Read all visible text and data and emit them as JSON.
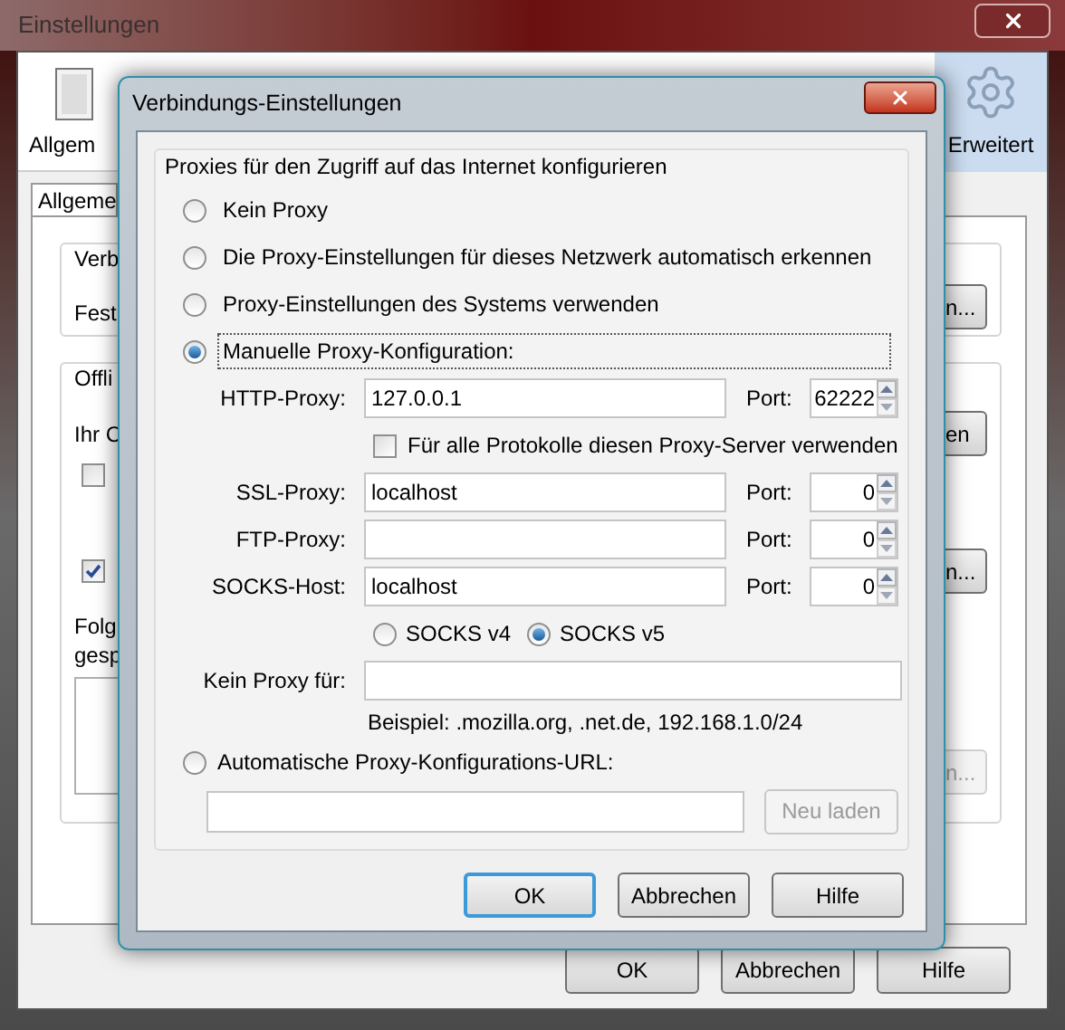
{
  "window": {
    "title": "Einstellungen"
  },
  "toolbar": [
    {
      "label": "Allgem",
      "selected": false
    },
    {
      "label": "Erweitert",
      "selected": true
    }
  ],
  "tab": {
    "label": "Allgeme",
    "selected": true
  },
  "background": {
    "group_1": [
      "Verb",
      "Fest"
    ],
    "group_2": [
      "Offli",
      "Ihr C",
      "Folg",
      "gesp"
    ],
    "checkboxes": [
      {
        "checked": false
      },
      {
        "checked": true
      }
    ],
    "side_buttons": [
      {
        "label": "n...",
        "disabled": false
      },
      {
        "label": "en",
        "disabled": false
      },
      {
        "label": "n...",
        "disabled": false
      },
      {
        "label": "n...",
        "disabled": true
      }
    ],
    "buttons": [
      "OK",
      "Abbrechen",
      "Hilfe"
    ]
  },
  "dialog": {
    "title": "Verbindungs-Einstellungen",
    "group_label": "Proxies für den Zugriff auf das Internet konfigurieren",
    "modes": [
      {
        "label": "Kein Proxy",
        "selected": false
      },
      {
        "label": "Die Proxy-Einstellungen für dieses Netzwerk automatisch erkennen",
        "selected": false
      },
      {
        "label": "Proxy-Einstellungen des Systems verwenden",
        "selected": false
      },
      {
        "label": "Manuelle Proxy-Konfiguration:",
        "selected": true
      }
    ],
    "proxies": [
      {
        "label": "HTTP-Proxy:",
        "value": "127.0.0.1",
        "port_label": "Port:",
        "port": "62222"
      },
      {
        "label": "SSL-Proxy:",
        "value": "localhost",
        "port_label": "Port:",
        "port": "0"
      },
      {
        "label": "FTP-Proxy:",
        "port_label": "Port:",
        "port": "0"
      },
      {
        "label": "SOCKS-Host:",
        "value": "localhost",
        "port_label": "Port:",
        "port": "0"
      }
    ],
    "share_all": {
      "label": "Für alle Protokolle diesen Proxy-Server verwenden",
      "checked": false
    },
    "socks_versions": [
      {
        "label": "SOCKS v4",
        "selected": false
      },
      {
        "label": "SOCKS v5",
        "selected": true
      }
    ],
    "no_proxy": {
      "label": "Kein Proxy für:"
    },
    "example": "Beispiel: .mozilla.org, .net.de, 192.168.1.0/24",
    "auto_url": {
      "label": "Automatische Proxy-Konfigurations-URL:",
      "selected": false,
      "reload_button": {
        "label": "Neu laden",
        "disabled": true
      }
    },
    "buttons": [
      {
        "label": "OK",
        "default": true
      },
      {
        "label": "Abbrechen",
        "default": false
      },
      {
        "label": "Hilfe",
        "default": false
      }
    ]
  }
}
